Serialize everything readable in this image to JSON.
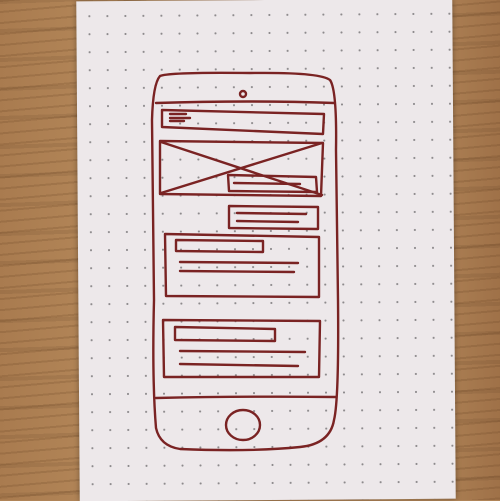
{
  "scene": {
    "surface": "wooden-table",
    "paper": "dot-grid-sheet",
    "drawing": "hand-drawn-mobile-wireframe"
  },
  "colors": {
    "ink": "#7a2323",
    "paper": "#ede8ea",
    "dots": "#8d8a8c",
    "wood": "#b08457"
  },
  "wireframe": {
    "device": "phone-outline",
    "sections": [
      "header-bar",
      "image-placeholder",
      "caption-tag",
      "small-tag",
      "text-card",
      "text-card"
    ]
  }
}
